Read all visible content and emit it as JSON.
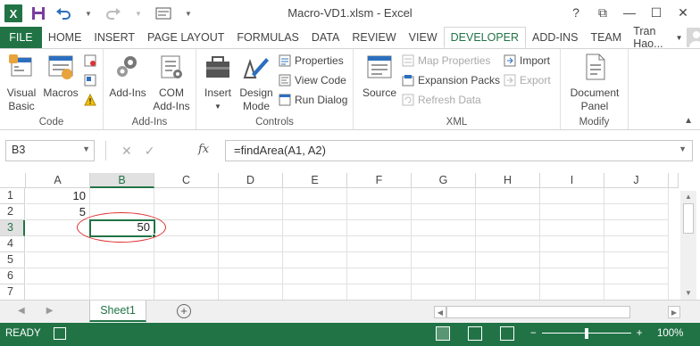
{
  "window": {
    "title": "Macro-VD1.xlsm - Excel",
    "help": "?",
    "restore": "⧉",
    "minimize": "—",
    "maximize": "☐",
    "close": "✕"
  },
  "qat": {
    "app_logo": "X"
  },
  "tabs": [
    "FILE",
    "HOME",
    "INSERT",
    "PAGE LAYOUT",
    "FORMULAS",
    "DATA",
    "REVIEW",
    "VIEW",
    "DEVELOPER",
    "ADD-INS",
    "TEAM"
  ],
  "active_tab": "DEVELOPER",
  "user": {
    "name": "Tran Hao..."
  },
  "ribbon": {
    "code": {
      "label": "Code",
      "visual_basic": "Visual Basic",
      "macros": "Macros"
    },
    "addins": {
      "label": "Add-Ins",
      "addins": "Add-Ins",
      "com_addins": "COM Add-Ins"
    },
    "controls": {
      "label": "Controls",
      "insert": "Insert",
      "design_mode": "Design Mode",
      "properties": "Properties",
      "view_code": "View Code",
      "run_dialog": "Run Dialog"
    },
    "xml": {
      "label": "XML",
      "source": "Source",
      "map_properties": "Map Properties",
      "expansion_packs": "Expansion Packs",
      "refresh_data": "Refresh Data",
      "import": "Import",
      "export": "Export"
    },
    "modify": {
      "label": "Modify",
      "document_panel": "Document Panel"
    }
  },
  "formula_bar": {
    "name_box": "B3",
    "cancel": "✕",
    "enter": "✓",
    "fx": "fx",
    "formula": "=findArea(A1, A2)"
  },
  "grid": {
    "columns": [
      "A",
      "B",
      "C",
      "D",
      "E",
      "F",
      "G",
      "H",
      "I",
      "J"
    ],
    "rows": [
      "1",
      "2",
      "3",
      "4",
      "5",
      "6",
      "7"
    ],
    "selected_column": "B",
    "selected_row": "3",
    "cells": {
      "A1": "10",
      "A2": "5",
      "B3": "50"
    }
  },
  "sheets": {
    "tabs": [
      "Sheet1"
    ],
    "add": "+"
  },
  "status": {
    "ready": "READY",
    "zoom_minus": "−",
    "zoom_plus": "+",
    "zoom": "100%"
  },
  "colors": {
    "accent": "#217346",
    "highlight_oval": "#e03030"
  }
}
